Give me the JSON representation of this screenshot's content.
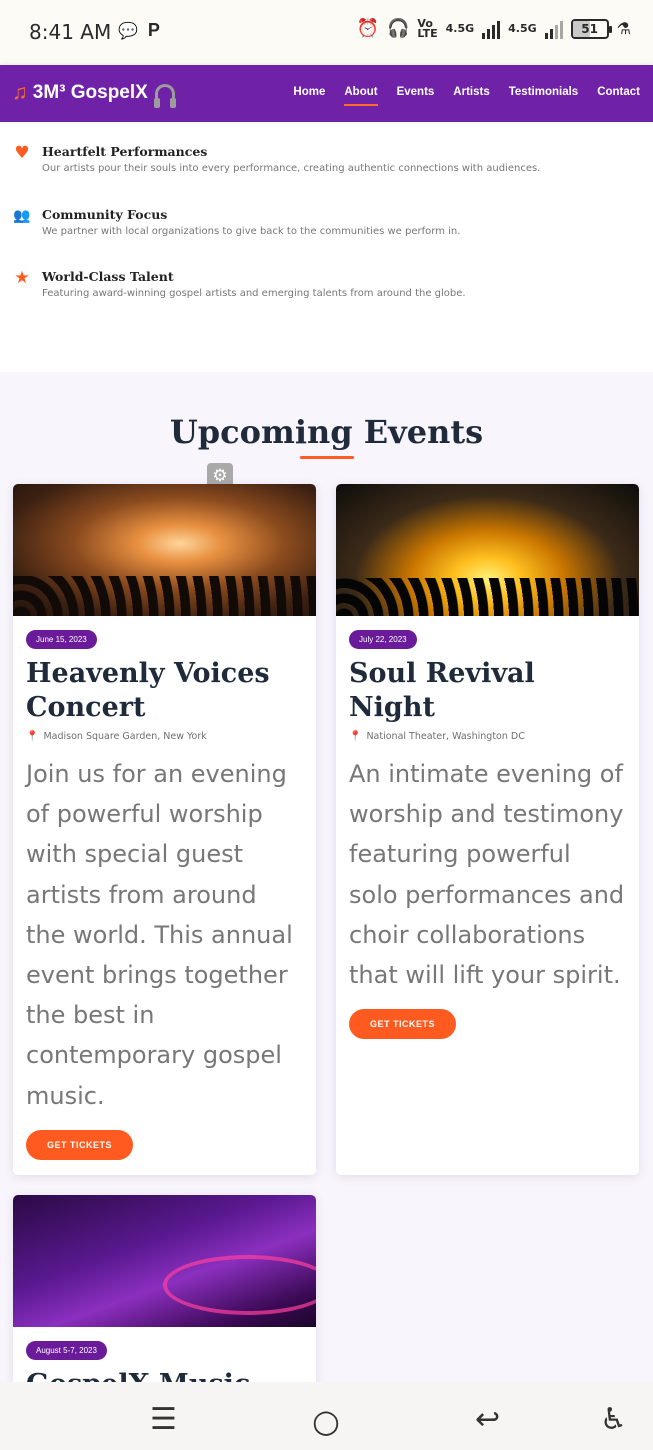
{
  "status_bar": {
    "time": "8:41 AM",
    "volte_top": "Vo",
    "volte_bottom": "LTE",
    "net1": "4.5G",
    "net2": "4.5G",
    "battery": "51"
  },
  "nav": {
    "brand": "3M³ GospelX",
    "links": [
      "Home",
      "About",
      "Events",
      "Artists",
      "Testimonials",
      "Contact"
    ],
    "active": "About"
  },
  "features": [
    {
      "icon": "heart-icon",
      "title": "Heartfelt Performances",
      "text": "Our artists pour their souls into every performance, creating authentic connections with audiences."
    },
    {
      "icon": "users-icon",
      "title": "Community Focus",
      "text": "We partner with local organizations to give back to the communities we perform in."
    },
    {
      "icon": "star-icon",
      "title": "World-Class Talent",
      "text": "Featuring award-winning gospel artists and emerging talents from around the globe."
    }
  ],
  "events": {
    "heading": "Upcoming Events",
    "cards": [
      {
        "date": "June 15, 2023",
        "title": "Heavenly Voices Concert",
        "location": "Madison Square Garden, New York",
        "description": "Join us for an evening of powerful worship with special guest artists from around the world. This annual event brings together the best in contemporary gospel music.",
        "button": "GET TICKETS"
      },
      {
        "date": "July 22, 2023",
        "title": "Soul Revival Night",
        "location": "National Theater, Washington DC",
        "description": "An intimate evening of worship and testimony featuring powerful solo performances and choir collaborations that will lift your spirit.",
        "button": "GET TICKETS"
      },
      {
        "date": "August 5-7, 2023",
        "title": "GospelX Music Festival"
      }
    ]
  },
  "colors": {
    "nav_bg": "#6f22a7",
    "accent": "#ff5a1f",
    "pill": "#6a1b9a",
    "heading": "#1f2b3a"
  }
}
